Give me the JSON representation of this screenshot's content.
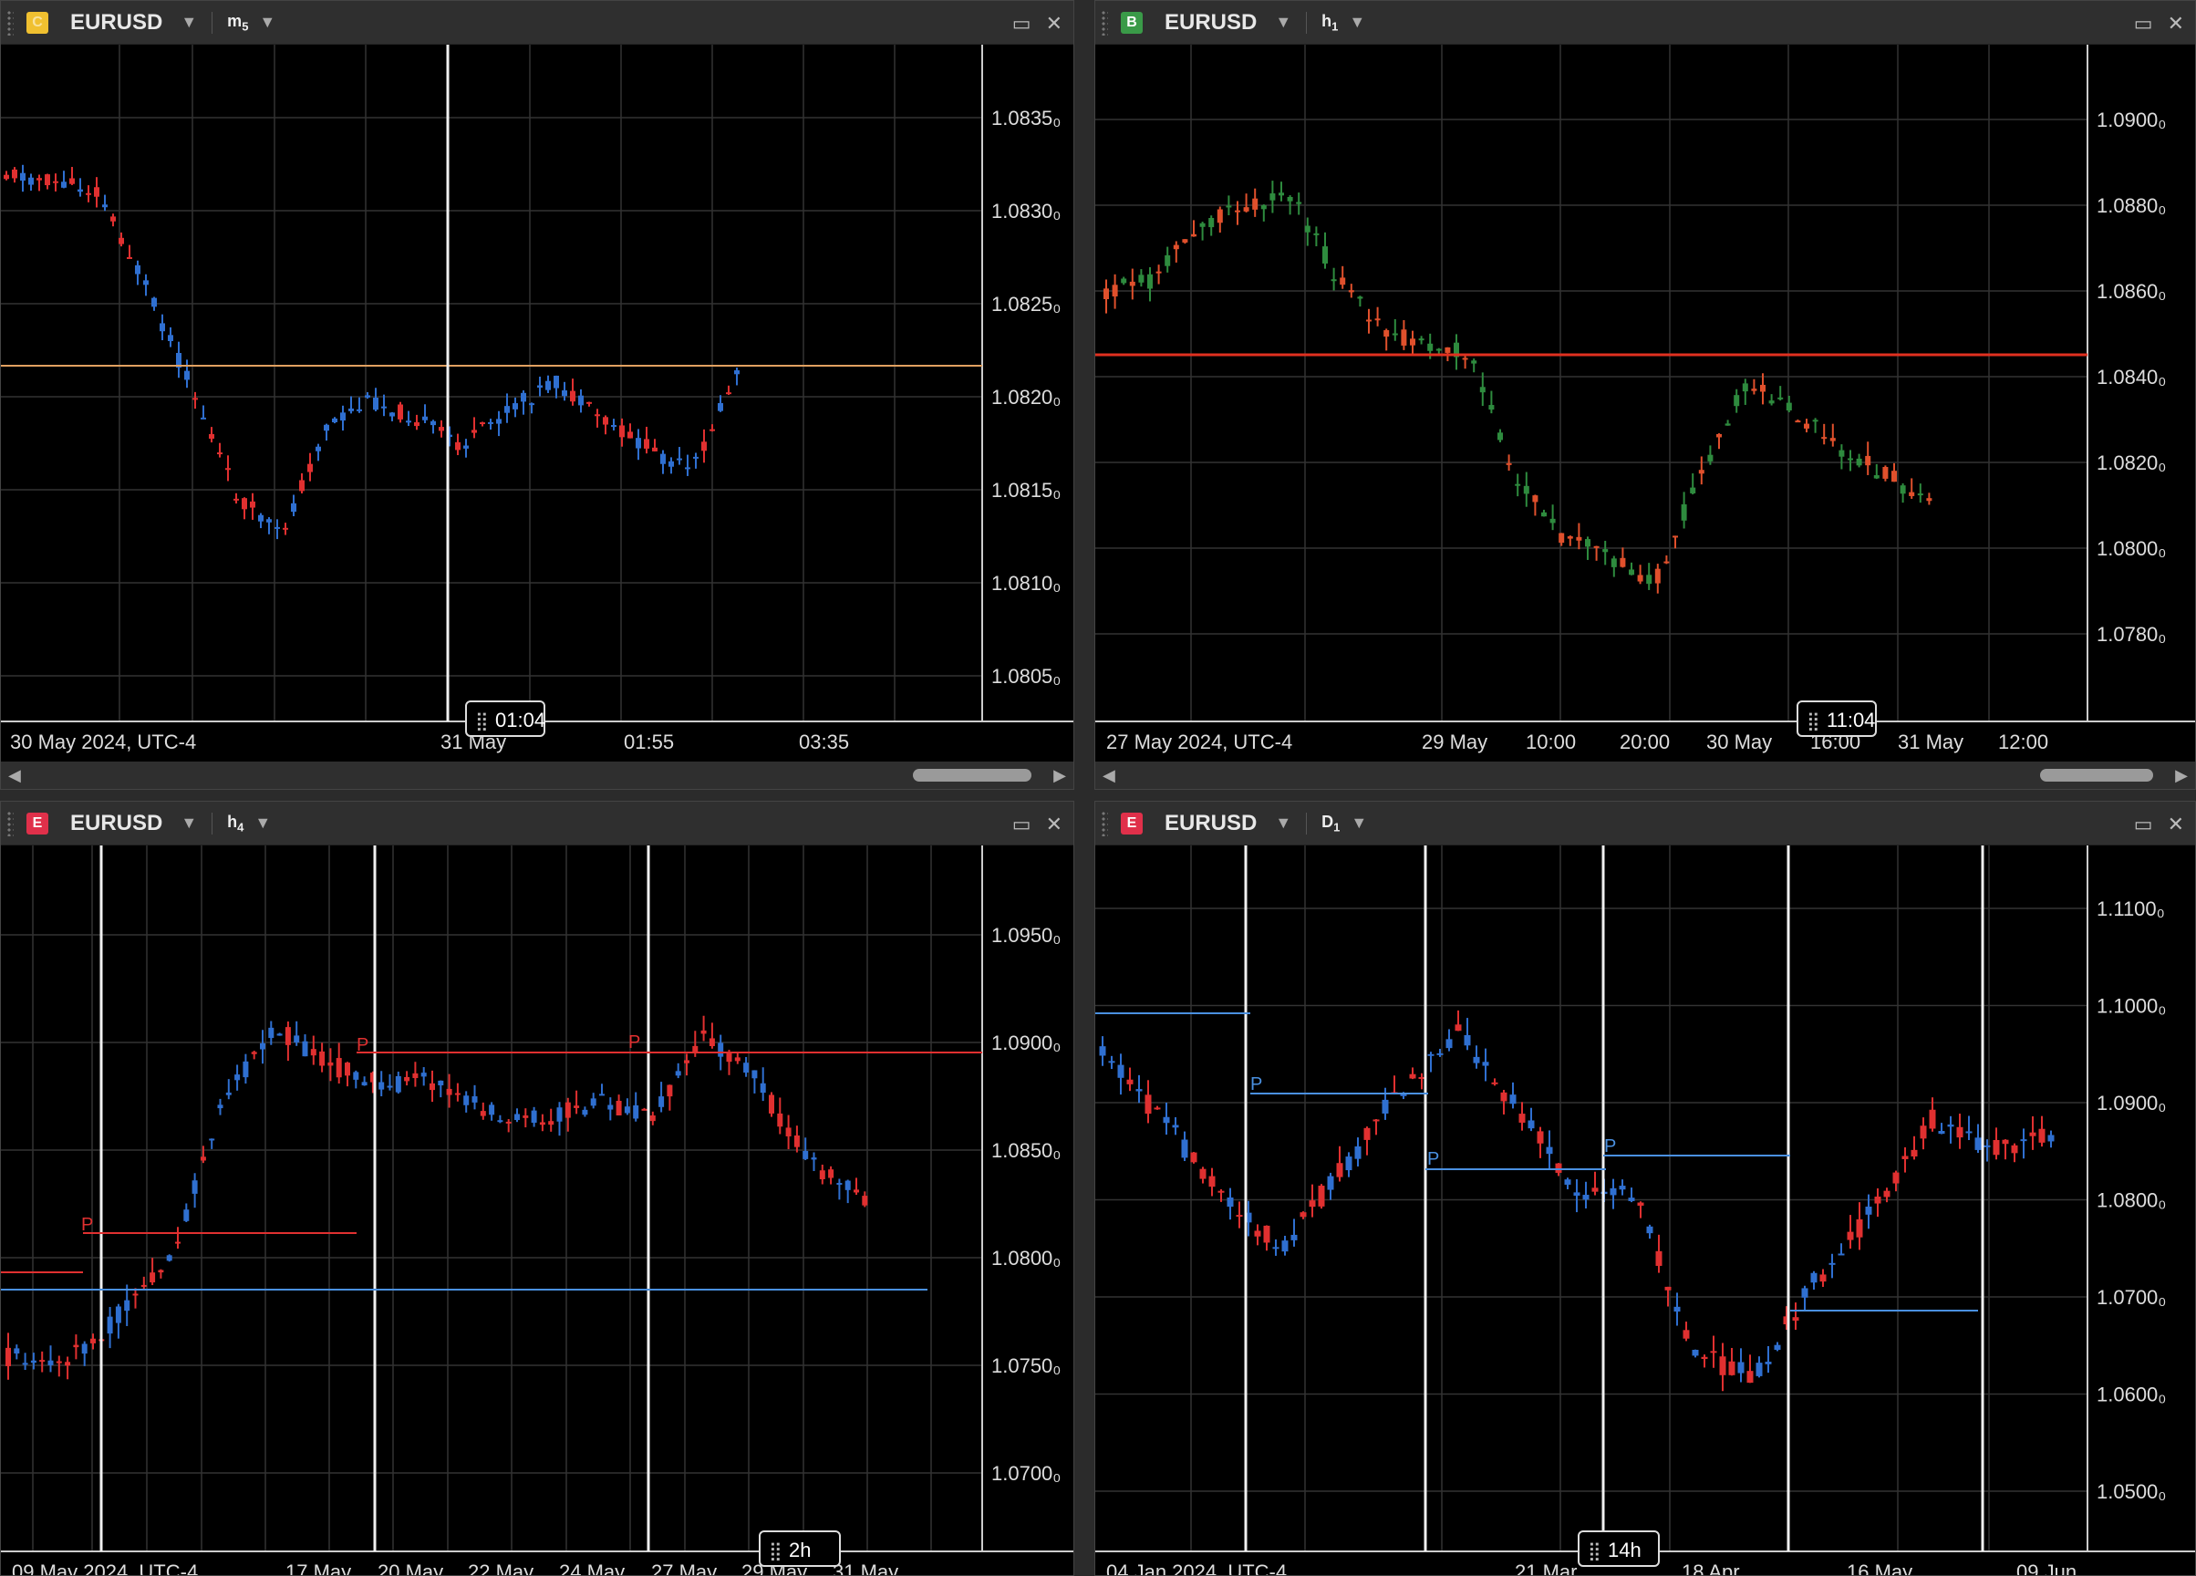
{
  "panels": [
    {
      "id": "p1",
      "badge": "C",
      "badge_color": "#f0c030",
      "symbol": "EURUSD",
      "timeframe_letter": "m",
      "timeframe_num": "5",
      "y_labels": [
        "1.0835₀",
        "1.0830₀",
        "1.0825₀",
        "1.0820₀",
        "1.0815₀",
        "1.0810₀",
        "1.0805₀"
      ],
      "x_labels": [
        "30 May 2024, UTC-4",
        "31 May",
        "01:55",
        "03:35"
      ],
      "cursor_label": "01:04",
      "hline_color": "#e0a060",
      "up_color": "#2f6fd0",
      "down_color": "#e03030"
    },
    {
      "id": "p2",
      "badge": "B",
      "badge_color": "#3a9a48",
      "symbol": "EURUSD",
      "timeframe_letter": "h",
      "timeframe_num": "1",
      "y_labels": [
        "1.0900₀",
        "1.0880₀",
        "1.0860₀",
        "1.0840₀",
        "1.0820₀",
        "1.0800₀",
        "1.0780₀"
      ],
      "x_labels": [
        "27 May 2024, UTC-4",
        "29 May",
        "10:00",
        "20:00",
        "30 May",
        "16:00",
        "31 May",
        "12:00"
      ],
      "cursor_label": "11:04",
      "hline_color": "#e03020",
      "up_color": "#2e8b3e",
      "down_color": "#e0502c"
    },
    {
      "id": "p3",
      "badge": "E",
      "badge_color": "#e0304a",
      "symbol": "EURUSD",
      "timeframe_letter": "h",
      "timeframe_num": "4",
      "y_labels": [
        "1.0950₀",
        "1.0900₀",
        "1.0850₀",
        "1.0800₀",
        "1.0750₀",
        "1.0700₀"
      ],
      "x_labels": [
        "09 May 2024, UTC-4",
        "17 May",
        "20 May",
        "22 May",
        "24 May",
        "27 May",
        "29 May",
        "31 May"
      ],
      "cursor_label": "2h",
      "marker_label": "P",
      "up_color": "#2f6fd0",
      "down_color": "#e03030"
    },
    {
      "id": "p4",
      "badge": "E",
      "badge_color": "#e0304a",
      "symbol": "EURUSD",
      "timeframe_letter": "D",
      "timeframe_num": "1",
      "y_labels": [
        "1.1100₀",
        "1.1000₀",
        "1.0900₀",
        "1.0800₀",
        "1.0700₀",
        "1.0600₀",
        "1.0500₀"
      ],
      "x_labels": [
        "04 Jan 2024, UTC-4",
        "21 Mar",
        "18 Apr",
        "16 May",
        "09 Jun"
      ],
      "cursor_label": "14h",
      "marker_label": "P",
      "up_color": "#2f6fd0",
      "down_color": "#e03030"
    }
  ],
  "ui": {
    "maximize_icon": "maximize-icon",
    "close_icon": "close-icon",
    "caret": "▼",
    "scroll_left": "◀",
    "scroll_right": "▶"
  }
}
